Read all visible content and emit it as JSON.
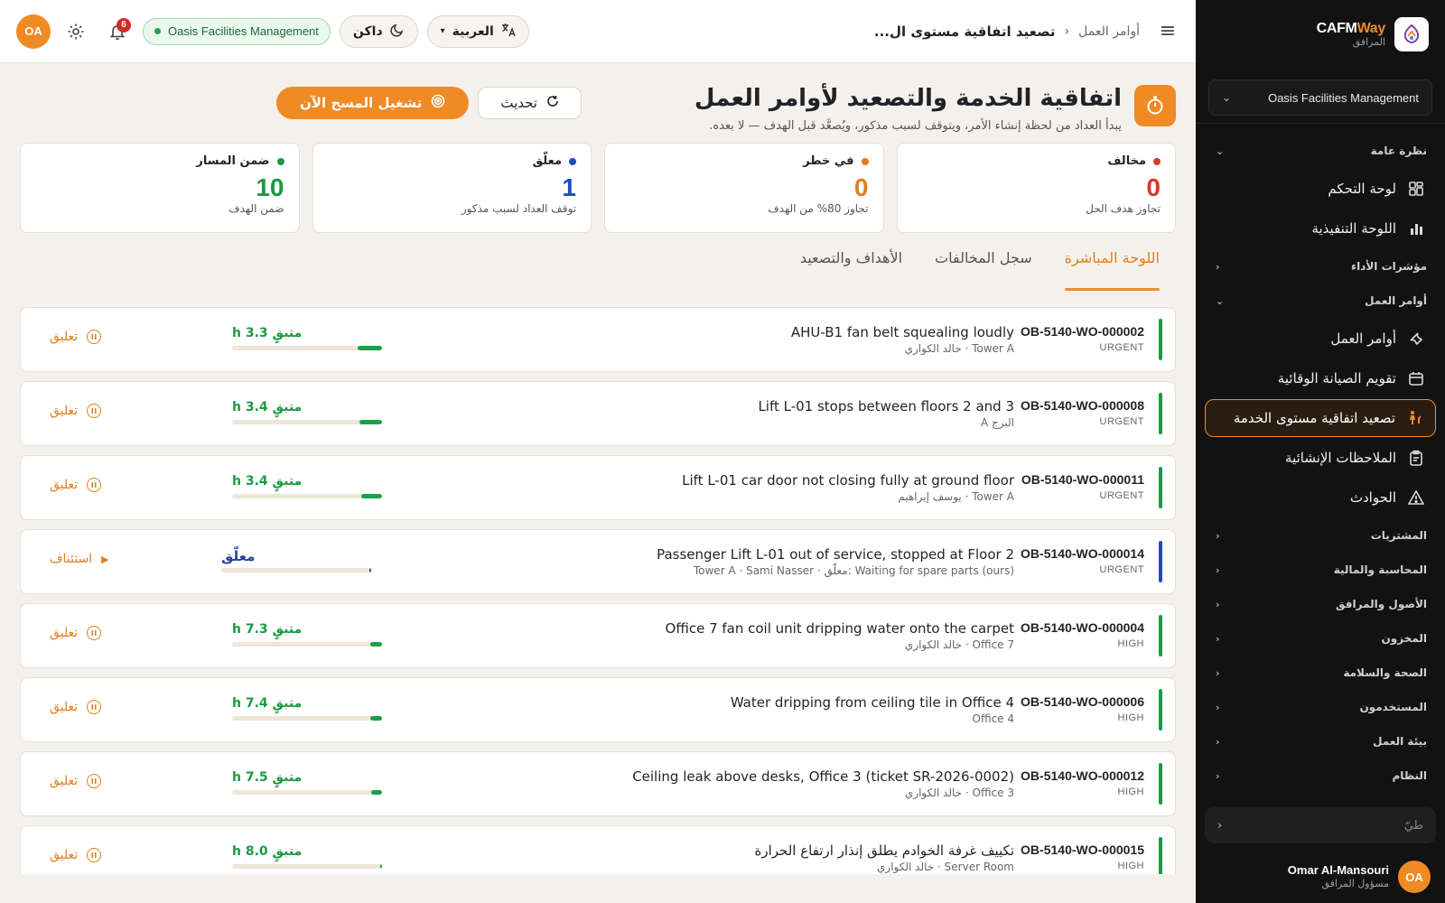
{
  "sidebar": {
    "brand_primary": "CAFM",
    "brand_accent": "Way",
    "brand_sub": "المرافق",
    "org_select": "Oasis Facilities Management",
    "sections": {
      "overview": "نظرة عامة",
      "kpis": "مؤشرات الأداء",
      "work_orders": "أوامر العمل",
      "procurement": "المشتريات",
      "finance": "المحاسبة والمالية",
      "assets": "الأصول والمرافق",
      "inventory": "المخزون",
      "hse": "الصحة والسلامة",
      "users": "المستخدمون",
      "workspace": "بيئة العمل",
      "system": "النظام"
    },
    "items": {
      "dashboard": "لوحة التحكم",
      "executive": "اللوحة التنفيذية",
      "work_orders": "أوامر العمل",
      "pm_calendar": "تقويم الصيانة الوقائية",
      "sla": "تصعيد اتفاقية مستوى الخدمة",
      "snags": "الملاحظات الإنشائية",
      "incidents": "الحوادث"
    },
    "search_placeholder": "طيّ",
    "user": {
      "initials": "OA",
      "name": "Omar Al-Mansouri",
      "role": "مسؤول المرافق"
    }
  },
  "topbar": {
    "breadcrumb_parent": "أوامر العمل",
    "breadcrumb_current": "تصعيد اتفاقية مستوى ال...",
    "language": "العربية",
    "theme": "داكن",
    "org": "Oasis Facilities Management",
    "notifications": "6",
    "avatar": "OA"
  },
  "page": {
    "title": "اتفاقية الخدمة والتصعيد لأوامر العمل",
    "subtitle": "يبدأ العداد من لحظة إنشاء الأمر، ويتوقف لسبب مذكور، ويُصعَّد قبل الهدف — لا بعده.",
    "refresh": "تحديث",
    "run_scan": "تشغيل المسح الآن"
  },
  "stats": [
    {
      "label": "مخالف",
      "value": "0",
      "desc": "تجاوز هدف الحل",
      "color": "#d43a2a"
    },
    {
      "label": "في خطر",
      "value": "0",
      "desc": "تجاوز 80% من الهدف",
      "color": "#e07f1c"
    },
    {
      "label": "معلّق",
      "value": "1",
      "desc": "توقف العداد لسبب مذكور",
      "color": "#2349c4"
    },
    {
      "label": "ضمن المسار",
      "value": "10",
      "desc": "ضمن الهدف",
      "color": "#1a9a43"
    }
  ],
  "tabs": [
    "اللوحة المباشرة",
    "سجل المخالفات",
    "الأهداف والتصعيد"
  ],
  "rows": [
    {
      "id": "OB-5140-WO-000002",
      "priority": "URGENT",
      "title": "AHU-B1 fan belt squealing loudly",
      "meta": "Tower A · خالد الكواري",
      "remaining": "متبقٍ 3.3 h",
      "progress": 0.16,
      "action": "تعليق",
      "paused": false
    },
    {
      "id": "OB-5140-WO-000008",
      "priority": "URGENT",
      "title": "Lift L-01 stops between floors 2 and 3",
      "meta": "البرج A",
      "remaining": "متبقٍ 3.4 h",
      "progress": 0.15,
      "action": "تعليق",
      "paused": false
    },
    {
      "id": "OB-5140-WO-000011",
      "priority": "URGENT",
      "title": "Lift L-01 car door not closing fully at ground floor",
      "meta": "Tower A · يوسف إبراهيم",
      "remaining": "متبقٍ 3.4 h",
      "progress": 0.14,
      "action": "تعليق",
      "paused": false
    },
    {
      "id": "OB-5140-WO-000014",
      "priority": "URGENT",
      "title": "Passenger Lift L-01 out of service, stopped at Floor 2",
      "meta": "Waiting for spare parts (ours) :معلّق · Tower A · Sami Nasser",
      "remaining": "معلّق",
      "progress": 0.01,
      "action": "استئناف",
      "paused": true
    },
    {
      "id": "OB-5140-WO-000004",
      "priority": "HIGH",
      "title": "Office 7 fan coil unit dripping water onto the carpet",
      "meta": "Office 7 · خالد الكواري",
      "remaining": "متبقٍ 7.3 h",
      "progress": 0.08,
      "action": "تعليق",
      "paused": false
    },
    {
      "id": "OB-5140-WO-000006",
      "priority": "HIGH",
      "title": "Water dripping from ceiling tile in Office 4",
      "meta": "Office 4",
      "remaining": "متبقٍ 7.4 h",
      "progress": 0.08,
      "action": "تعليق",
      "paused": false
    },
    {
      "id": "OB-5140-WO-000012",
      "priority": "HIGH",
      "title": "Ceiling leak above desks, Office 3 (ticket SR-2026-0002)",
      "meta": "Office 3 · خالد الكواري",
      "remaining": "متبقٍ 7.5 h",
      "progress": 0.07,
      "action": "تعليق",
      "paused": false
    },
    {
      "id": "OB-5140-WO-000015",
      "priority": "HIGH",
      "title": "تكييف غرفة الخوادم يطلق إنذار ارتفاع الحرارة",
      "meta": "Server Room · خالد الكواري",
      "remaining": "متبقٍ 8.0 h",
      "progress": 0.01,
      "action": "تعليق",
      "paused": false
    }
  ]
}
